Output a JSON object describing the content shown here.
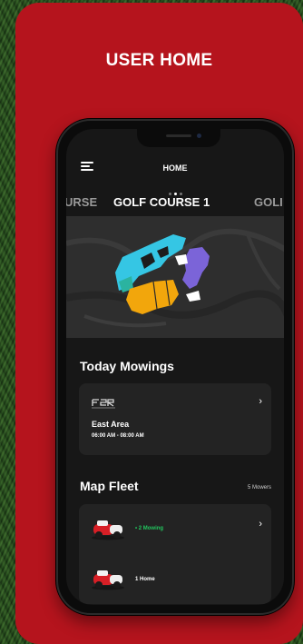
{
  "promo": {
    "title": "USER HOME"
  },
  "header": {
    "title": "HOME",
    "menu_icon": "hamburger-menu-icon"
  },
  "pager": {
    "total": 3,
    "active_index": 1
  },
  "courses": {
    "prev": "URSE",
    "current": "GOLF COURSE 1",
    "next": "GOLI"
  },
  "today_mowings": {
    "title": "Today Mowings",
    "items": [
      {
        "logo": "mower-brand-logo",
        "area": "East Area",
        "time": "06:00 AM - 08:00 AM"
      }
    ]
  },
  "map_fleet": {
    "title": "Map Fleet",
    "count_label": "5 Mowers",
    "groups": [
      {
        "status": "2 Mowing",
        "color": "#22c55e"
      },
      {
        "status": "1 Home",
        "color": "#ffffff"
      }
    ]
  },
  "colors": {
    "brand_red": "#b5141d",
    "map_cyan": "#35c6e4",
    "map_orange": "#f2a60c",
    "map_purple": "#7b64d8",
    "mowing_green": "#22c55e"
  }
}
